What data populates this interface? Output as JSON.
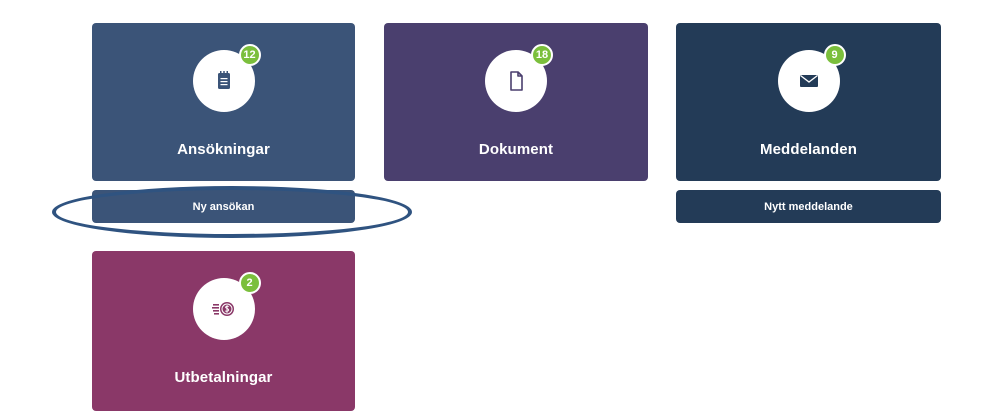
{
  "tiles": [
    {
      "id": "ansokningar",
      "title": "Ansökningar",
      "badge": "12",
      "icon": "notepad-icon",
      "color": "#3b5478"
    },
    {
      "id": "dokument",
      "title": "Dokument",
      "badge": "18",
      "icon": "document-icon",
      "color": "#4a3f6e"
    },
    {
      "id": "meddelanden",
      "title": "Meddelanden",
      "badge": "9",
      "icon": "envelope-icon",
      "color": "#233b57"
    },
    {
      "id": "utbetalningar",
      "title": "Utbetalningar",
      "badge": "2",
      "icon": "money-icon",
      "color": "#8a3868"
    }
  ],
  "actions": {
    "new_application": {
      "label": "Ny ansökan",
      "color": "#3b5478"
    },
    "new_message": {
      "label": "Nytt meddelande",
      "color": "#233b57"
    }
  },
  "badge_color": "#7bbf3c",
  "highlight_color": "#2f5380"
}
